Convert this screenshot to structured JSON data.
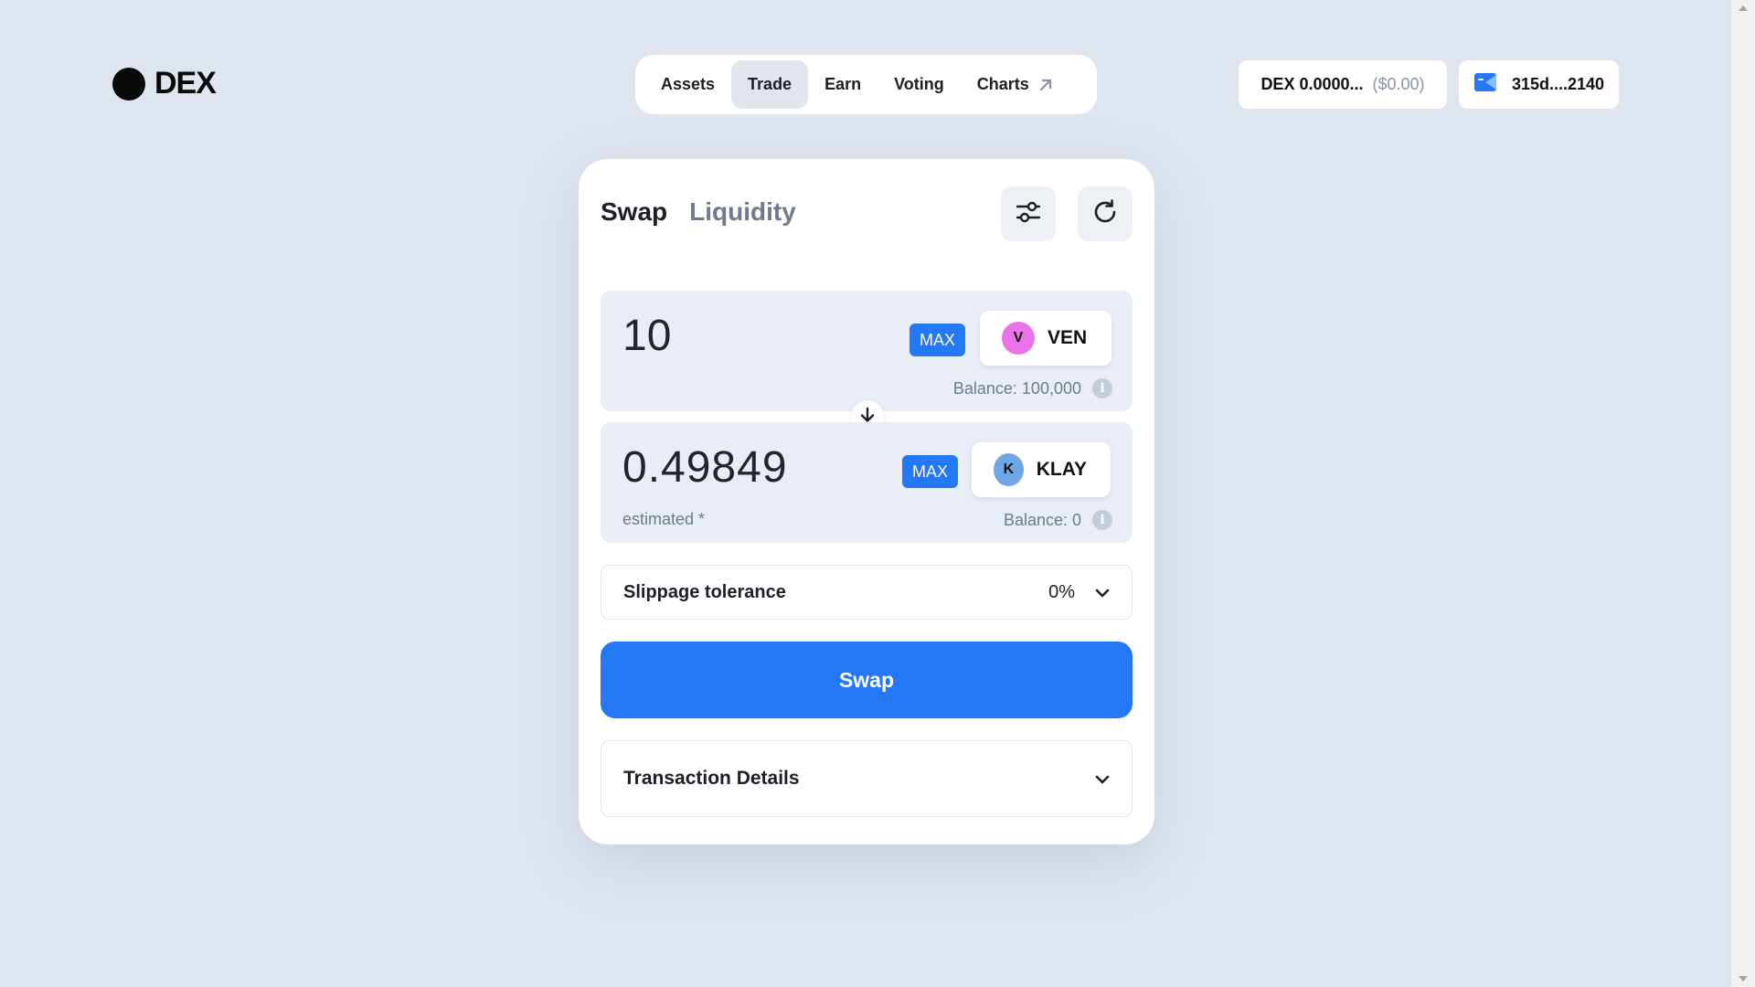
{
  "logo": {
    "text": "DEX"
  },
  "nav": {
    "items": [
      {
        "label": "Assets",
        "active": false
      },
      {
        "label": "Trade",
        "active": true
      },
      {
        "label": "Earn",
        "active": false
      },
      {
        "label": "Voting",
        "active": false
      },
      {
        "label": "Charts",
        "active": false,
        "icon": "external-arrow-icon"
      }
    ]
  },
  "header": {
    "token_balance": "DEX 0.0000...",
    "token_balance_usd": "($0.00)",
    "wallet_address": "315d....2140",
    "wallet_icon": "wallet-icon"
  },
  "swap": {
    "tabs": [
      {
        "label": "Swap",
        "active": true
      },
      {
        "label": "Liquidity",
        "active": false
      }
    ],
    "settings_icon": "sliders-icon",
    "refresh_icon": "refresh-icon",
    "from": {
      "amount": "10",
      "max_label": "MAX",
      "token_symbol": "VEN",
      "token_initial": "V",
      "token_color": "#e874e8",
      "balance": "Balance: 100,000"
    },
    "direction_icon": "arrow-down-icon",
    "to": {
      "amount": "0.49849",
      "note": "estimated *",
      "max_label": "MAX",
      "token_symbol": "KLAY",
      "token_initial": "K",
      "token_color": "#6ea6e6",
      "balance": "Balance: 0"
    },
    "slippage": {
      "label": "Slippage tolerance",
      "value": "0%"
    },
    "action_label": "Swap",
    "transaction_details_label": "Transaction Details",
    "accent_color": "#2477f5"
  }
}
